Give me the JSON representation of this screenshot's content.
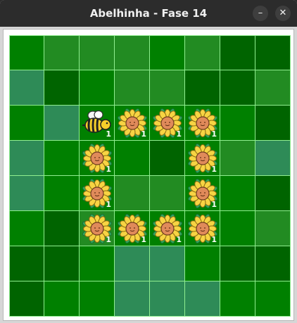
{
  "window": {
    "title": "Abelhinha - Fase 14",
    "minimize_glyph": "–",
    "close_glyph": "✕"
  },
  "colors": {
    "green": "#008000",
    "light_green": "#228b22",
    "dark_green": "#006400",
    "sea_green": "#2e8b57",
    "grid_line": "#90ee90",
    "count_text": "#ffffff"
  },
  "board": {
    "rows": 8,
    "cols": 8,
    "tiles": [
      [
        "green",
        "light_green",
        "light_green",
        "light_green",
        "green",
        "light_green",
        "dark_green",
        "dark_green"
      ],
      [
        "sea_green",
        "dark_green",
        "green",
        "light_green",
        "light_green",
        "dark_green",
        "dark_green",
        "light_green"
      ],
      [
        "green",
        "sea_green",
        "green",
        "green",
        "green",
        "green",
        "green",
        "dark_green"
      ],
      [
        "sea_green",
        "green",
        "green",
        "green",
        "dark_green",
        "green",
        "light_green",
        "sea_green"
      ],
      [
        "sea_green",
        "green",
        "green",
        "light_green",
        "light_green",
        "green",
        "green",
        "dark_green"
      ],
      [
        "green",
        "dark_green",
        "light_green",
        "green",
        "green",
        "green",
        "green",
        "light_green"
      ],
      [
        "dark_green",
        "dark_green",
        "green",
        "sea_green",
        "sea_green",
        "green",
        "dark_green",
        "dark_green"
      ],
      [
        "dark_green",
        "green",
        "green",
        "sea_green",
        "sea_green",
        "sea_green",
        "green",
        "green"
      ]
    ],
    "bee": {
      "row": 2,
      "col": 2,
      "icon": "bee-icon",
      "count": "1"
    },
    "flowers": [
      {
        "row": 2,
        "col": 3,
        "icon": "sunflower-icon",
        "count": "1"
      },
      {
        "row": 2,
        "col": 4,
        "icon": "sunflower-icon",
        "count": "1"
      },
      {
        "row": 2,
        "col": 5,
        "icon": "sunflower-icon",
        "count": "1"
      },
      {
        "row": 3,
        "col": 2,
        "icon": "sunflower-icon",
        "count": "1"
      },
      {
        "row": 3,
        "col": 5,
        "icon": "sunflower-icon",
        "count": "1"
      },
      {
        "row": 4,
        "col": 2,
        "icon": "sunflower-icon",
        "count": "1"
      },
      {
        "row": 4,
        "col": 5,
        "icon": "sunflower-icon",
        "count": "1"
      },
      {
        "row": 5,
        "col": 2,
        "icon": "sunflower-icon",
        "count": "1"
      },
      {
        "row": 5,
        "col": 3,
        "icon": "sunflower-icon",
        "count": "1"
      },
      {
        "row": 5,
        "col": 4,
        "icon": "sunflower-icon",
        "count": "1"
      },
      {
        "row": 5,
        "col": 5,
        "icon": "sunflower-icon",
        "count": "1"
      }
    ]
  }
}
